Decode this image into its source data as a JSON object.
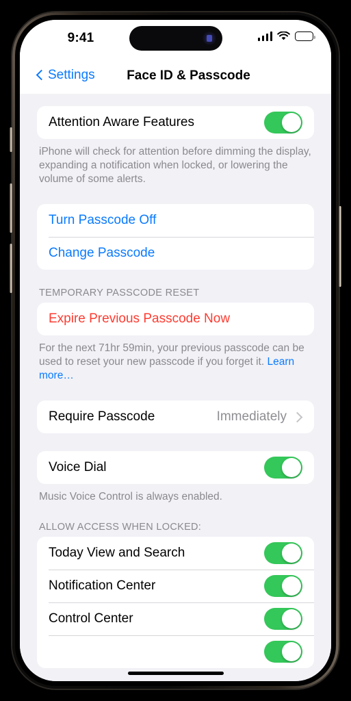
{
  "status_bar": {
    "time": "9:41",
    "cellular_icon": "signal-bars-icon",
    "wifi_icon": "wifi-icon",
    "battery_icon": "battery-icon"
  },
  "nav": {
    "back_label": "Settings",
    "title": "Face ID & Passcode"
  },
  "colors": {
    "accent_blue": "#0A7AFF",
    "destructive_red": "#FF3B30",
    "toggle_green": "#34C759",
    "background": "#F1F1F6",
    "card": "#FFFFFF",
    "secondary_text": "#8A8A8E"
  },
  "sections": {
    "attention": {
      "row_label": "Attention Aware Features",
      "toggle_state": "on",
      "footer": "iPhone will check for attention before dimming the display, expanding a notification when locked, or lowering the volume of some alerts."
    },
    "passcode_actions": {
      "turn_off_label": "Turn Passcode Off",
      "change_label": "Change Passcode"
    },
    "temporary_reset": {
      "header": "TEMPORARY PASSCODE RESET",
      "expire_label": "Expire Previous Passcode Now",
      "footer": "For the next 71hr 59min, your previous passcode can be used to reset your new passcode if you forget it.",
      "learn_more": "Learn more…"
    },
    "require_passcode": {
      "label": "Require Passcode",
      "value": "Immediately"
    },
    "voice_dial": {
      "label": "Voice Dial",
      "toggle_state": "on",
      "footer": "Music Voice Control is always enabled."
    },
    "allow_access": {
      "header": "ALLOW ACCESS WHEN LOCKED:",
      "items": [
        {
          "label": "Today View and Search",
          "toggle_state": "on"
        },
        {
          "label": "Notification Center",
          "toggle_state": "on"
        },
        {
          "label": "Control Center",
          "toggle_state": "on"
        }
      ]
    }
  }
}
